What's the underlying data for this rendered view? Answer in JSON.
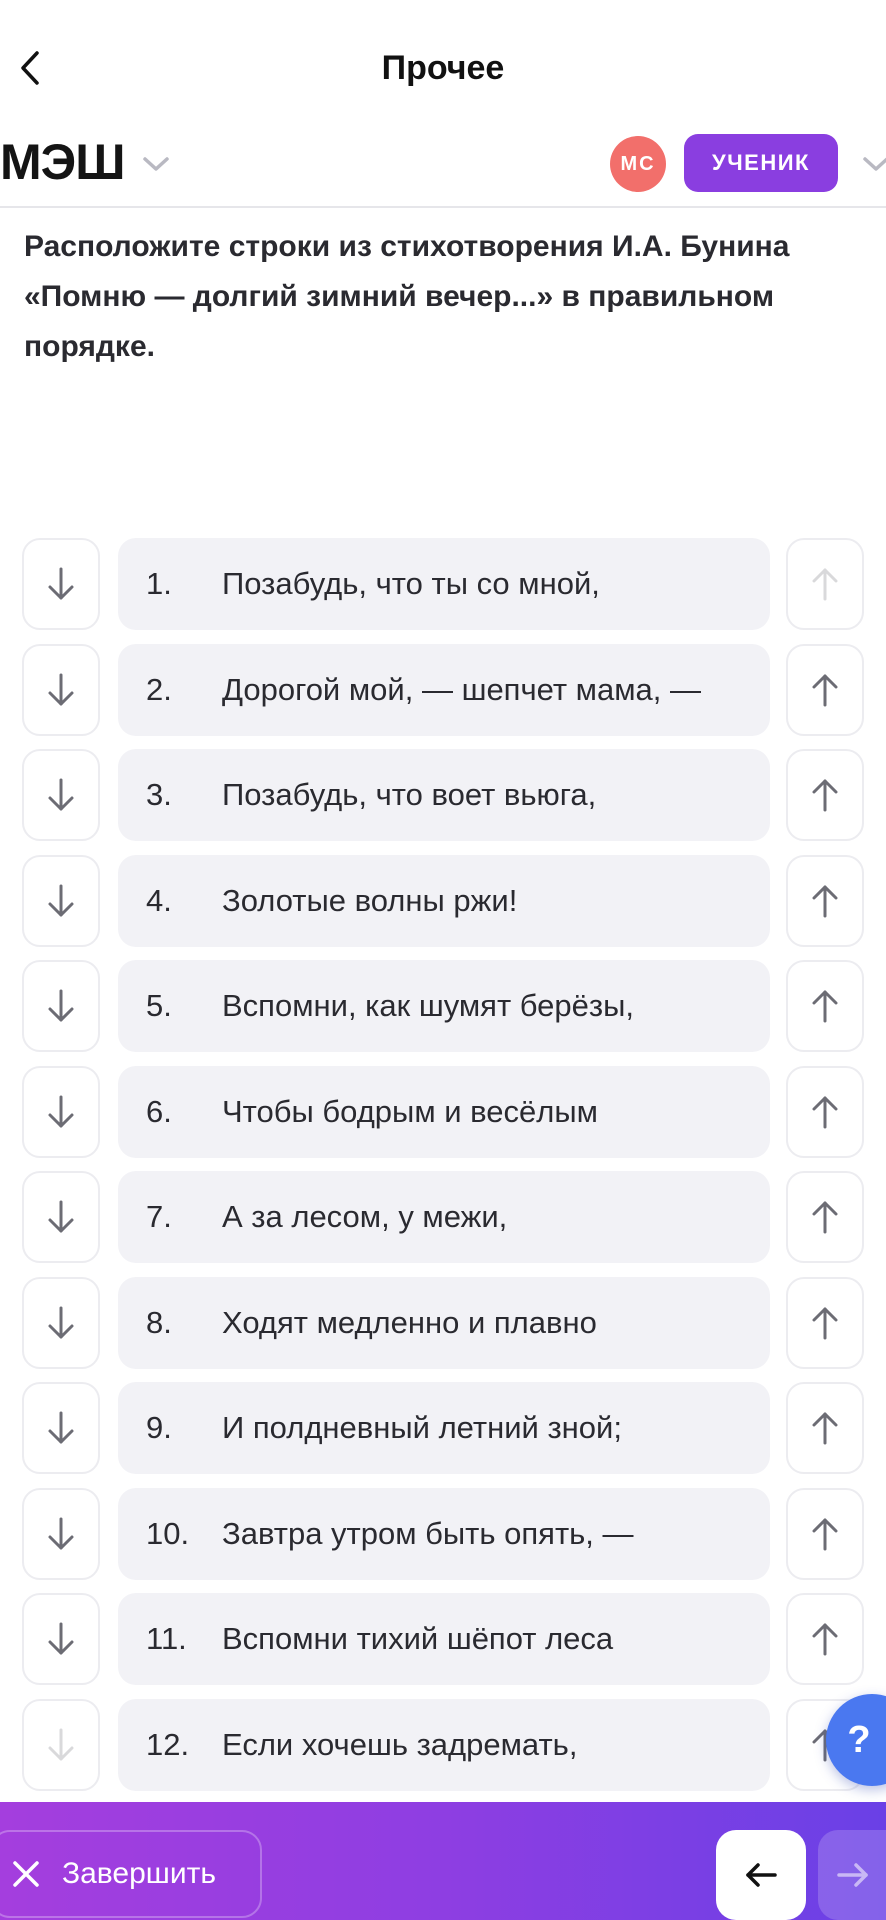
{
  "nav": {
    "title": "Прочее",
    "back_icon": "chevron-left-icon"
  },
  "header": {
    "logo": "МЭШ",
    "avatar_initials": "МС",
    "role": "УЧЕНИК",
    "colors": {
      "avatar": "#f26f6b",
      "role_badge": "#8a3ee0"
    }
  },
  "question": "Расположите строки из стихотворения И.А. Бунина «Помню — долгий зимний вечер...» в правильном порядке.",
  "lines": [
    {
      "num": "1.",
      "text": "Позабудь, что ты со мной,"
    },
    {
      "num": "2.",
      "text": "Дорогой мой, — шепчет мама, —"
    },
    {
      "num": "3.",
      "text": "Позабудь, что воет вьюга,"
    },
    {
      "num": "4.",
      "text": "Золотые волны ржи!"
    },
    {
      "num": "5.",
      "text": "Вспомни, как шумят берёзы,"
    },
    {
      "num": "6.",
      "text": "Чтобы бодрым и весёлым"
    },
    {
      "num": "7.",
      "text": "А за лесом, у межи,"
    },
    {
      "num": "8.",
      "text": "Ходят медленно и плавно"
    },
    {
      "num": "9.",
      "text": "И полдневный летний зной;"
    },
    {
      "num": "10.",
      "text": "Завтра утром быть опять, —"
    },
    {
      "num": "11.",
      "text": "Вспомни тихий шёпот леса"
    },
    {
      "num": "12.",
      "text": "Если хочешь задремать,"
    }
  ],
  "help": {
    "label": "?"
  },
  "footer": {
    "finish_label": "Завершить",
    "colors": {
      "gradient_start": "#a43ede",
      "gradient_end": "#6a40e6"
    }
  }
}
